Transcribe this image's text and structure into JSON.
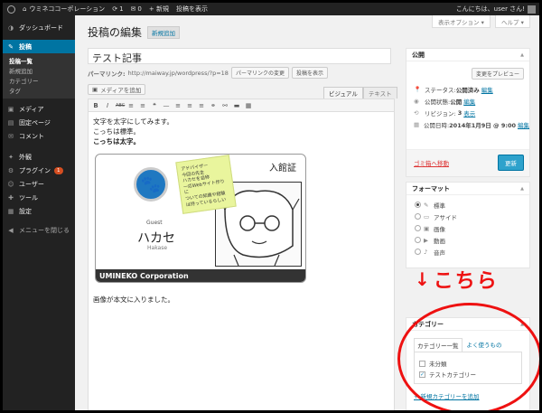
{
  "adminbar": {
    "site_name": "ウミネココーポレーション",
    "updates_count": "1",
    "comments_count": "0",
    "new_label": "+ 新規",
    "view_post": "投稿を表示",
    "greeting": "こんにちは、user さん!"
  },
  "sidebar": {
    "items": [
      {
        "icon": "dashboard-icon",
        "glyph": "◑",
        "label": "ダッシュボード"
      },
      {
        "icon": "pin-icon",
        "glyph": "✎",
        "label": "投稿"
      },
      {
        "icon": "media-icon",
        "glyph": "▣",
        "label": "メディア"
      },
      {
        "icon": "page-icon",
        "glyph": "▤",
        "label": "固定ページ"
      },
      {
        "icon": "comment-icon",
        "glyph": "✉",
        "label": "コメント"
      },
      {
        "icon": "appearance-icon",
        "glyph": "✦",
        "label": "外観"
      },
      {
        "icon": "plugin-icon",
        "glyph": "⚙",
        "label": "プラグイン",
        "badge": "1"
      },
      {
        "icon": "users-icon",
        "glyph": "☺",
        "label": "ユーザー"
      },
      {
        "icon": "tools-icon",
        "glyph": "✚",
        "label": "ツール"
      },
      {
        "icon": "settings-icon",
        "glyph": "▦",
        "label": "設定"
      },
      {
        "icon": "collapse-icon",
        "glyph": "◀",
        "label": "メニューを閉じる"
      }
    ],
    "submenu": [
      "投稿一覧",
      "新規追加",
      "カテゴリー",
      "タグ"
    ]
  },
  "header": {
    "screen_options": "表示オプション ▾",
    "help": "ヘルプ ▾",
    "page_title": "投稿の編集",
    "add_new": "新規追加"
  },
  "editor": {
    "post_title": "テスト記事",
    "permalink_label": "パーマリンク:",
    "permalink_url": "http://maiway.jp/wordpress/?p=18",
    "change_permalink": "パーマリンクの変更",
    "view_post": "投稿を表示",
    "add_media": "メディアを追加",
    "tab_visual": "ビジュアル",
    "tab_text": "テキスト",
    "toolbar": [
      "B",
      "I",
      "ABC",
      "≡",
      "≡",
      "❝",
      "—",
      "≡",
      "≡",
      "≡",
      "⚭",
      "⚯",
      "▬",
      "▦"
    ],
    "lines": [
      "文字を太字にしてみます。",
      "こっちは標準。",
      "こっちは太字。"
    ],
    "after_image": "画像が本文に入りました。"
  },
  "idcard": {
    "title": "入館証",
    "guest": "Guest",
    "name": "ハカセ",
    "name_en": "Hakase",
    "footer": "UMINEKO Corporation",
    "sticky_lines": [
      "アドバイザー",
      "今回の先生",
      "ハカセを自称",
      "一応Webサイト作りに",
      "ついての知識や経験",
      "は持っているらしい"
    ]
  },
  "publish": {
    "heading": "公開",
    "preview": "変更をプレビュー",
    "status_label": "ステータス:",
    "status_value": "公開済み",
    "visibility_label": "公開状態:",
    "visibility_value": "公開",
    "revisions_label": "リビジョン:",
    "revisions_value": "3",
    "revisions_link": "表示",
    "date_label": "公開日時:",
    "date_value": "2014年1月9日 @ 9:00",
    "edit": "編集",
    "trash": "ゴミ箱へ移動",
    "update": "更新"
  },
  "format": {
    "heading": "フォーマット",
    "options": [
      {
        "icon": "pin-icon",
        "glyph": "✎",
        "label": "標準",
        "checked": true
      },
      {
        "icon": "aside-icon",
        "glyph": "▭",
        "label": "アサイド",
        "checked": false
      },
      {
        "icon": "image-icon",
        "glyph": "▣",
        "label": "画像",
        "checked": false
      },
      {
        "icon": "video-icon",
        "glyph": "▶",
        "label": "動画",
        "checked": false
      },
      {
        "icon": "audio-icon",
        "glyph": "♪",
        "label": "音声",
        "checked": false
      }
    ]
  },
  "categories": {
    "heading": "カテゴリー",
    "tab_all": "カテゴリー一覧",
    "tab_popular": "よく使うもの",
    "items": [
      {
        "label": "未分類",
        "checked": false
      },
      {
        "label": "テストカテゴリー",
        "checked": true
      }
    ],
    "add_new": "+ 新規カテゴリーを追加"
  },
  "annotation": {
    "text": "こちら",
    "color": "#ee1111"
  },
  "colors": {
    "accent": "#0074a2",
    "update_button": "#2ea2cc",
    "trash": "#dd3333"
  }
}
